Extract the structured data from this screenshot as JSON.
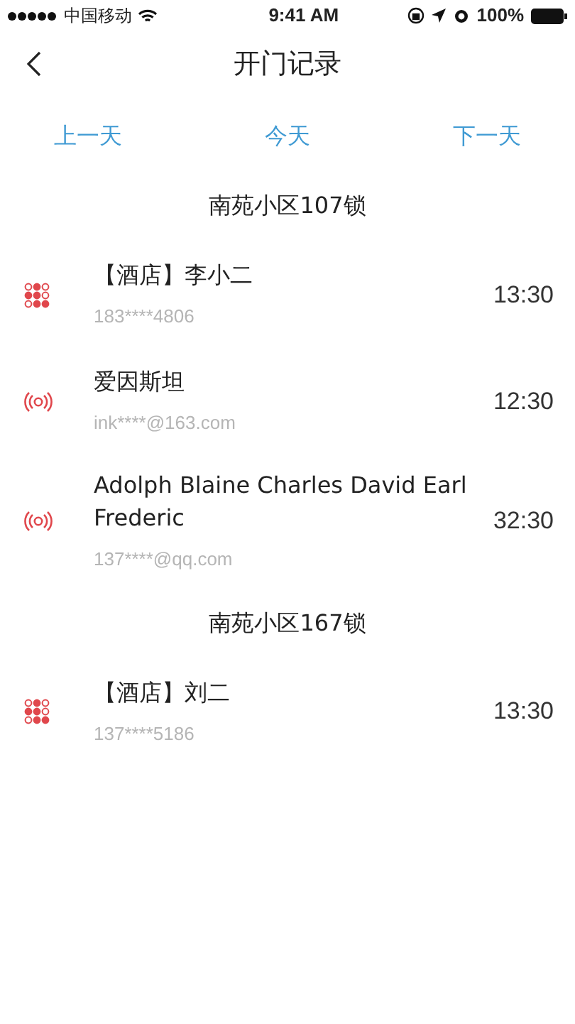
{
  "status_bar": {
    "carrier": "中国移动",
    "time": "9:41 AM",
    "battery": "100%"
  },
  "nav": {
    "title": "开门记录"
  },
  "day_tabs": [
    {
      "label": "上一天"
    },
    {
      "label": "今天"
    },
    {
      "label": "下一天"
    }
  ],
  "sections": [
    {
      "title": "南苑小区107锁",
      "records": [
        {
          "kind": "keypad",
          "name": "【酒店】李小二",
          "account": "183****4806",
          "time": "13:30"
        },
        {
          "kind": "card",
          "name": "爱因斯坦",
          "account": "ink****@163.com",
          "time": "12:30"
        },
        {
          "kind": "card",
          "name": "Adolph Blaine Charles David Earl Frederic",
          "account": "137****@qq.com",
          "time": "32:30"
        }
      ]
    },
    {
      "title": "南苑小区167锁",
      "records": [
        {
          "kind": "keypad",
          "name": "【酒店】刘二",
          "account": "137****5186",
          "time": "13:30"
        }
      ]
    }
  ]
}
